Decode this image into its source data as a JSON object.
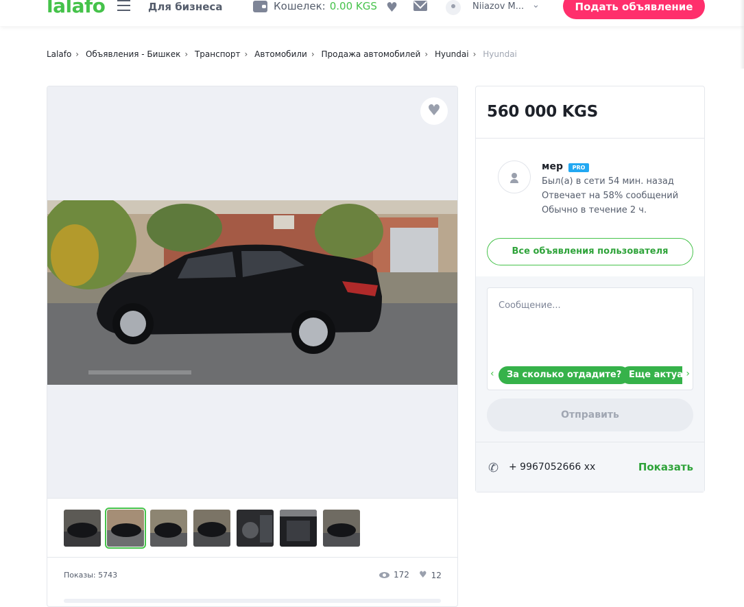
{
  "header": {
    "logo": "lalafo",
    "for_business": "Для бизнеса",
    "wallet_label": "Кошелек:",
    "wallet_amount": "0.00 KGS",
    "user_name": "Niiazov M...",
    "post_ad": "Подать объявление"
  },
  "breadcrumb": [
    "Lalafo",
    "Объявления - Бишкек",
    "Транспорт",
    "Автомобили",
    "Продажа автомобилей",
    "Hyundai",
    "Hyundai"
  ],
  "gallery": {
    "thumbnail_count": 7,
    "active_thumbnail": 2,
    "views_label": "Показы: 5743",
    "eye_count": "172",
    "like_count": "12"
  },
  "panel": {
    "price": "560 000 KGS",
    "seller_name": "мер",
    "pro_badge": "PRO",
    "last_seen": "Был(а) в сети 54 мин. назад",
    "reply_rate": "Отвечает на 58% сообщений",
    "reply_time": "Обычно в течение 2 ч.",
    "all_ads": "Все объявления пользователя",
    "message_placeholder": "Сообщение...",
    "chips": [
      "За сколько отдадите?",
      "Еще актуал"
    ],
    "send": "Отправить",
    "phone": "+ 9967052666 xx",
    "show": "Показать"
  }
}
